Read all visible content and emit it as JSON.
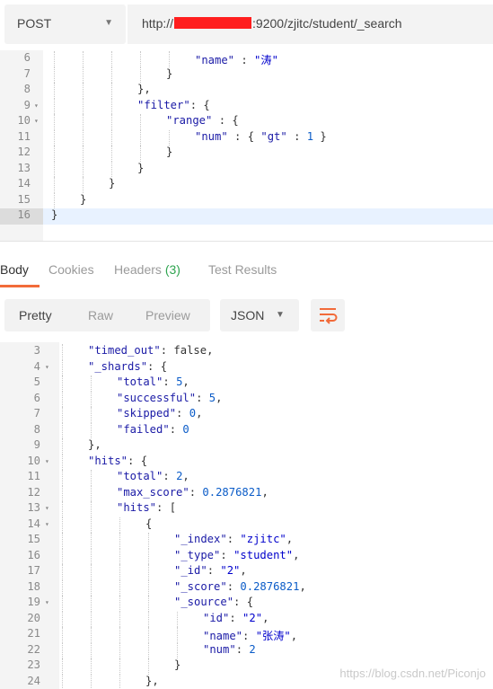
{
  "request": {
    "method": "POST",
    "url_prefix": "http://",
    "url_suffix": ":9200/zjitc/student/_search"
  },
  "request_body": {
    "lines": [
      {
        "n": "6",
        "fold": "",
        "indent": 5,
        "parts": [
          [
            "s",
            "\"name\""
          ],
          [
            "pun",
            " : "
          ],
          [
            "str",
            "\"涛\""
          ]
        ]
      },
      {
        "n": "7",
        "fold": "",
        "indent": 4,
        "parts": [
          [
            "pun",
            "}"
          ]
        ]
      },
      {
        "n": "8",
        "fold": "",
        "indent": 3,
        "parts": [
          [
            "pun",
            "},"
          ]
        ]
      },
      {
        "n": "9",
        "fold": "▾",
        "indent": 3,
        "parts": [
          [
            "s",
            "\"filter\""
          ],
          [
            "pun",
            ": {"
          ]
        ]
      },
      {
        "n": "10",
        "fold": "▾",
        "indent": 4,
        "parts": [
          [
            "s",
            "\"range\""
          ],
          [
            "pun",
            " : {"
          ]
        ]
      },
      {
        "n": "11",
        "fold": "",
        "indent": 5,
        "parts": [
          [
            "s",
            "\"num\""
          ],
          [
            "pun",
            " : { "
          ],
          [
            "s",
            "\"gt\""
          ],
          [
            "pun",
            " : "
          ],
          [
            "num",
            "1"
          ],
          [
            "pun",
            " }"
          ]
        ]
      },
      {
        "n": "12",
        "fold": "",
        "indent": 4,
        "parts": [
          [
            "pun",
            "}"
          ]
        ]
      },
      {
        "n": "13",
        "fold": "",
        "indent": 3,
        "parts": [
          [
            "pun",
            "}"
          ]
        ]
      },
      {
        "n": "14",
        "fold": "",
        "indent": 2,
        "parts": [
          [
            "pun",
            "}"
          ]
        ]
      },
      {
        "n": "15",
        "fold": "",
        "indent": 1,
        "parts": [
          [
            "pun",
            "}"
          ]
        ]
      },
      {
        "n": "16",
        "fold": "",
        "indent": 0,
        "parts": [
          [
            "pun",
            "}"
          ]
        ]
      }
    ]
  },
  "response_tabs": {
    "body": "Body",
    "cookies": "Cookies",
    "headers": "Headers",
    "headers_count": "(3)",
    "test_results": "Test Results"
  },
  "view": {
    "pretty": "Pretty",
    "raw": "Raw",
    "preview": "Preview",
    "format": "JSON",
    "wrap_icon": "wrap-lines-icon"
  },
  "response_body": {
    "lines": [
      {
        "n": "3",
        "fold": "",
        "indent": 1,
        "parts": [
          [
            "s",
            "\"timed_out\""
          ],
          [
            "pun",
            ": "
          ],
          [
            "kw",
            "false"
          ],
          [
            "pun",
            ","
          ]
        ]
      },
      {
        "n": "4",
        "fold": "▾",
        "indent": 1,
        "parts": [
          [
            "s",
            "\"_shards\""
          ],
          [
            "pun",
            ": {"
          ]
        ]
      },
      {
        "n": "5",
        "fold": "",
        "indent": 2,
        "parts": [
          [
            "s",
            "\"total\""
          ],
          [
            "pun",
            ": "
          ],
          [
            "num",
            "5"
          ],
          [
            "pun",
            ","
          ]
        ]
      },
      {
        "n": "6",
        "fold": "",
        "indent": 2,
        "parts": [
          [
            "s",
            "\"successful\""
          ],
          [
            "pun",
            ": "
          ],
          [
            "num",
            "5"
          ],
          [
            "pun",
            ","
          ]
        ]
      },
      {
        "n": "7",
        "fold": "",
        "indent": 2,
        "parts": [
          [
            "s",
            "\"skipped\""
          ],
          [
            "pun",
            ": "
          ],
          [
            "num",
            "0"
          ],
          [
            "pun",
            ","
          ]
        ]
      },
      {
        "n": "8",
        "fold": "",
        "indent": 2,
        "parts": [
          [
            "s",
            "\"failed\""
          ],
          [
            "pun",
            ": "
          ],
          [
            "num",
            "0"
          ]
        ]
      },
      {
        "n": "9",
        "fold": "",
        "indent": 1,
        "parts": [
          [
            "pun",
            "},"
          ]
        ]
      },
      {
        "n": "10",
        "fold": "▾",
        "indent": 1,
        "parts": [
          [
            "s",
            "\"hits\""
          ],
          [
            "pun",
            ": {"
          ]
        ]
      },
      {
        "n": "11",
        "fold": "",
        "indent": 2,
        "parts": [
          [
            "s",
            "\"total\""
          ],
          [
            "pun",
            ": "
          ],
          [
            "num",
            "2"
          ],
          [
            "pun",
            ","
          ]
        ]
      },
      {
        "n": "12",
        "fold": "",
        "indent": 2,
        "parts": [
          [
            "s",
            "\"max_score\""
          ],
          [
            "pun",
            ": "
          ],
          [
            "num",
            "0.2876821"
          ],
          [
            "pun",
            ","
          ]
        ]
      },
      {
        "n": "13",
        "fold": "▾",
        "indent": 2,
        "parts": [
          [
            "s",
            "\"hits\""
          ],
          [
            "pun",
            ": ["
          ]
        ]
      },
      {
        "n": "14",
        "fold": "▾",
        "indent": 3,
        "parts": [
          [
            "pun",
            "{"
          ]
        ]
      },
      {
        "n": "15",
        "fold": "",
        "indent": 4,
        "parts": [
          [
            "s",
            "\"_index\""
          ],
          [
            "pun",
            ": "
          ],
          [
            "str",
            "\"zjitc\""
          ],
          [
            "pun",
            ","
          ]
        ]
      },
      {
        "n": "16",
        "fold": "",
        "indent": 4,
        "parts": [
          [
            "s",
            "\"_type\""
          ],
          [
            "pun",
            ": "
          ],
          [
            "str",
            "\"student\""
          ],
          [
            "pun",
            ","
          ]
        ]
      },
      {
        "n": "17",
        "fold": "",
        "indent": 4,
        "parts": [
          [
            "s",
            "\"_id\""
          ],
          [
            "pun",
            ": "
          ],
          [
            "str",
            "\"2\""
          ],
          [
            "pun",
            ","
          ]
        ]
      },
      {
        "n": "18",
        "fold": "",
        "indent": 4,
        "parts": [
          [
            "s",
            "\"_score\""
          ],
          [
            "pun",
            ": "
          ],
          [
            "num",
            "0.2876821"
          ],
          [
            "pun",
            ","
          ]
        ]
      },
      {
        "n": "19",
        "fold": "▾",
        "indent": 4,
        "parts": [
          [
            "s",
            "\"_source\""
          ],
          [
            "pun",
            ": {"
          ]
        ]
      },
      {
        "n": "20",
        "fold": "",
        "indent": 5,
        "parts": [
          [
            "s",
            "\"id\""
          ],
          [
            "pun",
            ": "
          ],
          [
            "str",
            "\"2\""
          ],
          [
            "pun",
            ","
          ]
        ]
      },
      {
        "n": "21",
        "fold": "",
        "indent": 5,
        "parts": [
          [
            "s",
            "\"name\""
          ],
          [
            "pun",
            ": "
          ],
          [
            "str",
            "\"张涛\""
          ],
          [
            "pun",
            ","
          ]
        ]
      },
      {
        "n": "22",
        "fold": "",
        "indent": 5,
        "parts": [
          [
            "s",
            "\"num\""
          ],
          [
            "pun",
            ": "
          ],
          [
            "num",
            "2"
          ]
        ]
      },
      {
        "n": "23",
        "fold": "",
        "indent": 4,
        "parts": [
          [
            "pun",
            "}"
          ]
        ]
      },
      {
        "n": "24",
        "fold": "",
        "indent": 3,
        "parts": [
          [
            "pun",
            "},"
          ]
        ]
      }
    ]
  },
  "watermark": "https://blog.csdn.net/Piconjo",
  "colors": {
    "accent": "#f26b3a",
    "count_green": "#2ea44f",
    "key_blue": "#1a1aa6",
    "redaction": "#ff1e1e"
  }
}
